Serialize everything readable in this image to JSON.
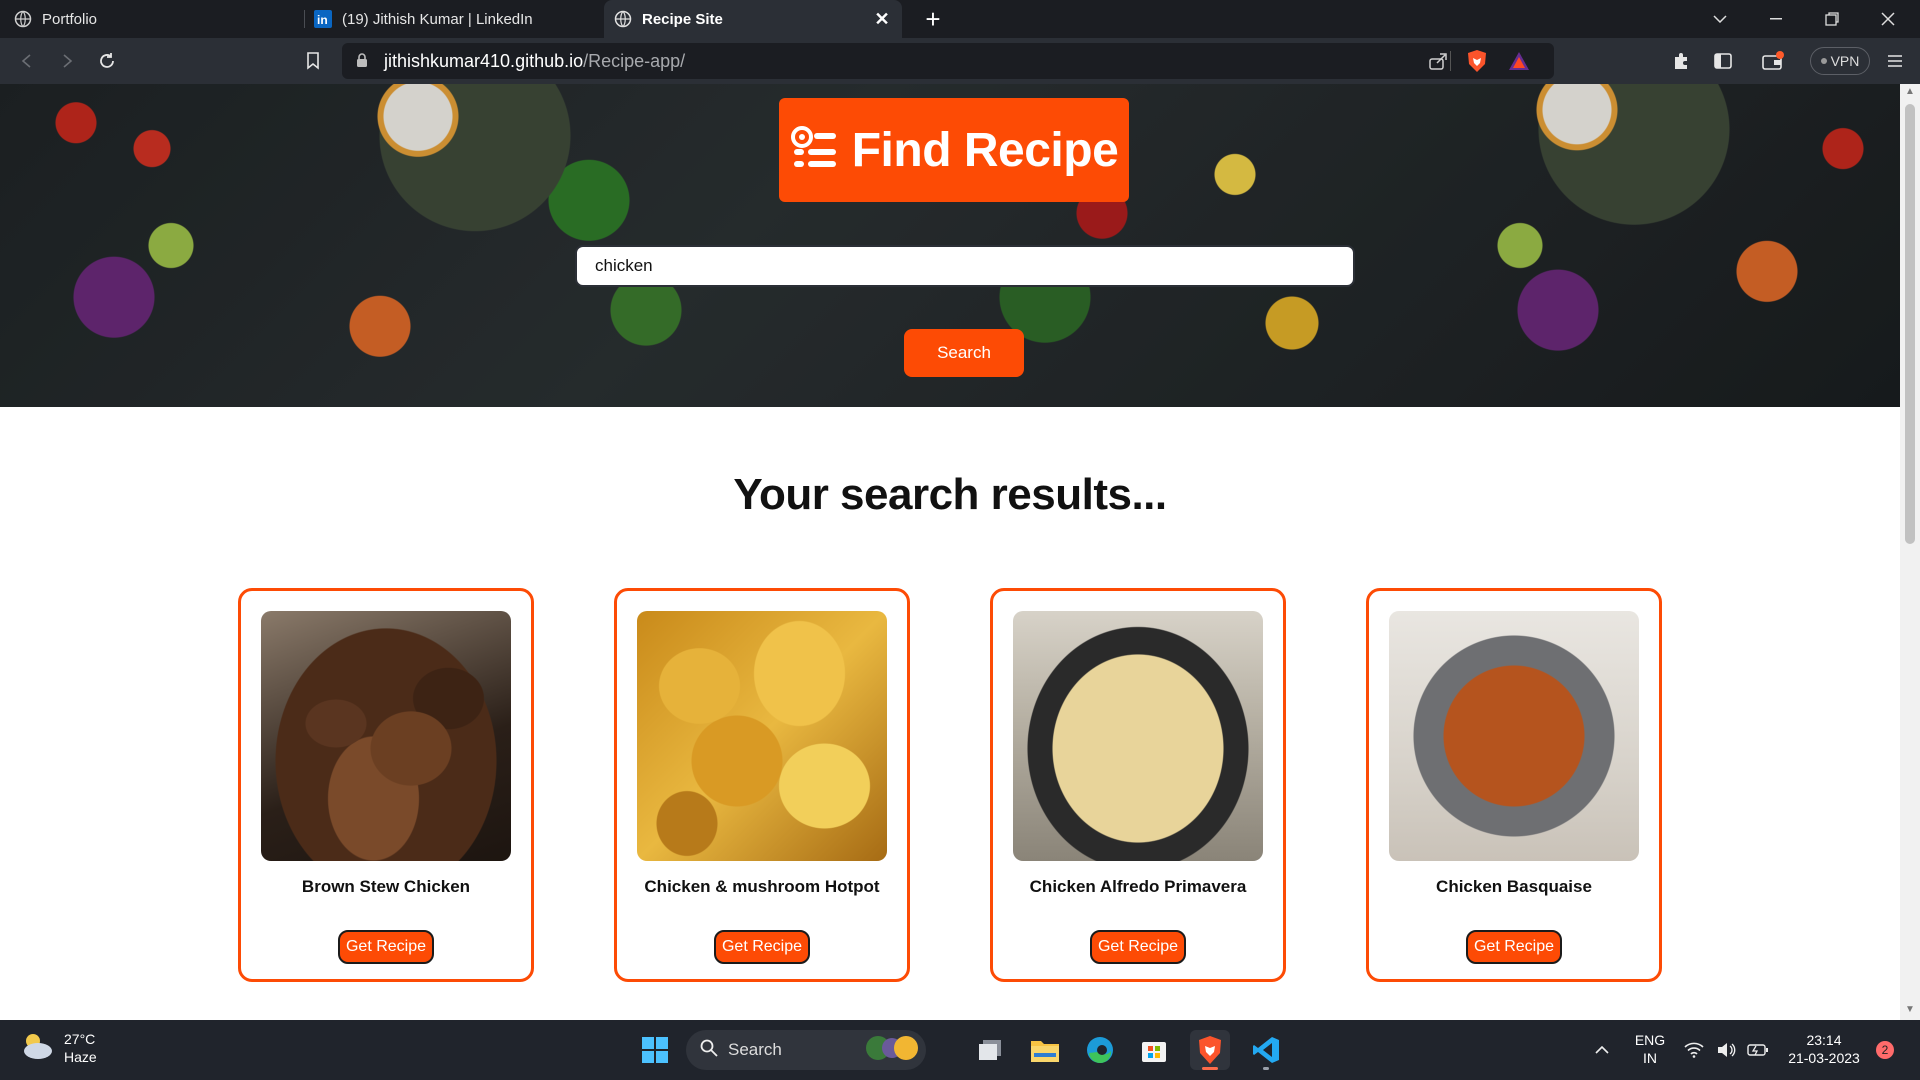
{
  "browser": {
    "tabs": [
      {
        "label": "Portfolio",
        "active": false
      },
      {
        "label": "(19) Jithish Kumar | LinkedIn",
        "active": false
      },
      {
        "label": "Recipe Site",
        "active": true
      }
    ],
    "url_host": "jithishkumar410.github.io",
    "url_path": "/Recipe-app/",
    "vpn_label": "VPN"
  },
  "page": {
    "logo_text": "Find Recipe",
    "search_value": "chicken",
    "search_button": "Search",
    "results_heading": "Your search results...",
    "cards": [
      {
        "title": "Brown Stew Chicken",
        "button": "Get Recipe"
      },
      {
        "title": "Chicken & mushroom Hotpot",
        "button": "Get Recipe"
      },
      {
        "title": "Chicken Alfredo Primavera",
        "button": "Get Recipe"
      },
      {
        "title": "Chicken Basquaise",
        "button": "Get Recipe"
      }
    ],
    "accent_color": "#fd4b05"
  },
  "taskbar": {
    "weather_temp": "27°C",
    "weather_desc": "Haze",
    "search_label": "Search",
    "lang_top": "ENG",
    "lang_bottom": "IN",
    "time": "23:14",
    "date": "21-03-2023",
    "notifications": "2"
  }
}
